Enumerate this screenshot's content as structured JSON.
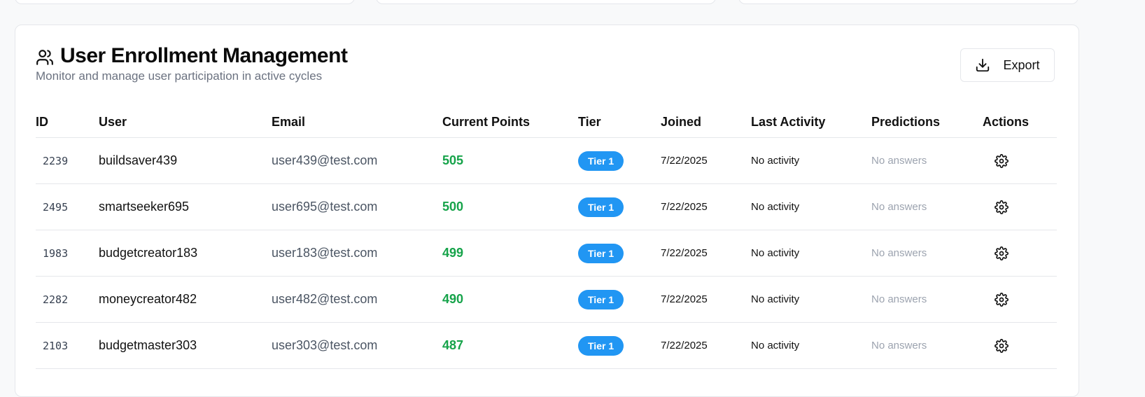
{
  "header": {
    "icon": "users-icon",
    "title": "User Enrollment Management",
    "subtitle": "Monitor and manage user participation in active cycles",
    "export_label": "Export",
    "export_icon": "download-icon"
  },
  "table": {
    "columns": [
      "ID",
      "User",
      "Email",
      "Current Points",
      "Tier",
      "Joined",
      "Last Activity",
      "Predictions",
      "Actions"
    ],
    "rows": [
      {
        "id": "2239",
        "user": "buildsaver439",
        "email": "user439@test.com",
        "points": "505",
        "tier": "Tier 1",
        "joined": "7/22/2025",
        "last": "No activity",
        "pred": "No answers"
      },
      {
        "id": "2495",
        "user": "smartseeker695",
        "email": "user695@test.com",
        "points": "500",
        "tier": "Tier 1",
        "joined": "7/22/2025",
        "last": "No activity",
        "pred": "No answers"
      },
      {
        "id": "1983",
        "user": "budgetcreator183",
        "email": "user183@test.com",
        "points": "499",
        "tier": "Tier 1",
        "joined": "7/22/2025",
        "last": "No activity",
        "pred": "No answers"
      },
      {
        "id": "2282",
        "user": "moneycreator482",
        "email": "user482@test.com",
        "points": "490",
        "tier": "Tier 1",
        "joined": "7/22/2025",
        "last": "No activity",
        "pred": "No answers"
      },
      {
        "id": "2103",
        "user": "budgetmaster303",
        "email": "user303@test.com",
        "points": "487",
        "tier": "Tier 1",
        "joined": "7/22/2025",
        "last": "No activity",
        "pred": "No answers"
      }
    ],
    "action_icon": "gear-icon"
  },
  "colors": {
    "points": "#16a34a",
    "tier_badge": "#2196f3",
    "muted": "#9ca3af"
  }
}
